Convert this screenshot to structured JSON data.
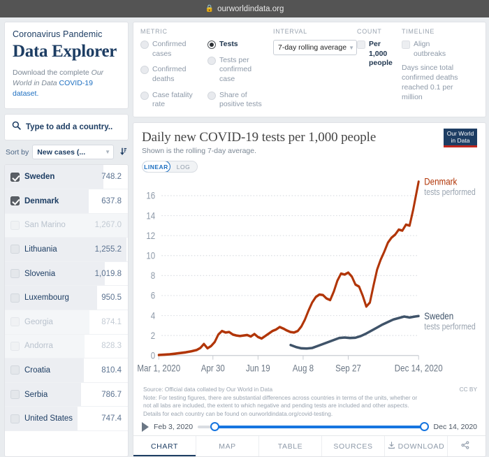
{
  "browser": {
    "url": "ourworldindata.org",
    "lock_icon": "lock-icon"
  },
  "brand": {
    "subtitle": "Coronavirus Pandemic",
    "title": "Data Explorer",
    "desc_1": "Download the complete ",
    "desc_italic": "Our World in Data",
    "desc_link": " COVID-19 dataset.",
    "desc_2": ""
  },
  "search": {
    "placeholder": "Type to add a country..",
    "value": "",
    "icon": "search-icon"
  },
  "sort": {
    "label": "Sort by",
    "value": "New cases (...",
    "direction_icon": "sort-descending-icon"
  },
  "countries": [
    {
      "name": "Sweden",
      "value": "748.2",
      "selected": true,
      "dim": false,
      "bar": 80
    },
    {
      "name": "Denmark",
      "value": "637.8",
      "selected": true,
      "dim": false,
      "bar": 68
    },
    {
      "name": "San Marino",
      "value": "1,267.0",
      "selected": false,
      "dim": true,
      "bar": 100
    },
    {
      "name": "Lithuania",
      "value": "1,255.2",
      "selected": false,
      "dim": false,
      "bar": 99
    },
    {
      "name": "Slovenia",
      "value": "1,019.8",
      "selected": false,
      "dim": false,
      "bar": 81
    },
    {
      "name": "Luxembourg",
      "value": "950.5",
      "selected": false,
      "dim": false,
      "bar": 75
    },
    {
      "name": "Georgia",
      "value": "874.1",
      "selected": false,
      "dim": true,
      "bar": 69
    },
    {
      "name": "Andorra",
      "value": "828.3",
      "selected": false,
      "dim": true,
      "bar": 65
    },
    {
      "name": "Croatia",
      "value": "810.4",
      "selected": false,
      "dim": false,
      "bar": 64
    },
    {
      "name": "Serbia",
      "value": "786.7",
      "selected": false,
      "dim": false,
      "bar": 62
    },
    {
      "name": "United States",
      "value": "747.4",
      "selected": false,
      "dim": false,
      "bar": 59
    }
  ],
  "controls": {
    "metric": {
      "label": "METRIC",
      "options_left": [
        {
          "label": "Confirmed cases",
          "selected": false
        },
        {
          "label": "Confirmed deaths",
          "selected": false
        },
        {
          "label": "Case fatality rate",
          "selected": false
        }
      ],
      "options_right": [
        {
          "label": "Tests",
          "selected": true
        },
        {
          "label": "Tests per confirmed case",
          "selected": false
        },
        {
          "label": "Share of positive tests",
          "selected": false
        }
      ]
    },
    "interval": {
      "label": "INTERVAL",
      "value": "7-day rolling average"
    },
    "count": {
      "label": "COUNT",
      "option": "Per 1,000 people",
      "checked": true
    },
    "timeline": {
      "label": "TIMELINE",
      "option": "Align outbreaks",
      "checked": false,
      "note": "Days since total confirmed deaths reached 0.1 per million"
    }
  },
  "chart": {
    "title": "Daily new COVID-19 tests per 1,000 people",
    "subtitle": "Shown is the rolling 7-day average.",
    "logo_line1": "Our World",
    "logo_line2": "in Data",
    "scale": {
      "linear": "LINEAR",
      "log": "LOG",
      "active": "LINEAR"
    },
    "source": "Source: Official data collated by Our World in Data",
    "note_line1": "Note: For testing figures, there are substantial differences across countries in terms of the units, whether or",
    "note_line2": "not all labs are included, the extent to which negative and pending tests are included and other aspects.",
    "note_line3": "Details for each country can be found on ourworldindata.org/covid-testing.",
    "license": "CC BY"
  },
  "timeline_slider": {
    "start": "Feb 3, 2020",
    "end": "Dec 14, 2020",
    "play_icon": "play-icon"
  },
  "tabs": [
    {
      "label": "CHART",
      "active": true,
      "icon": ""
    },
    {
      "label": "MAP",
      "active": false,
      "icon": ""
    },
    {
      "label": "TABLE",
      "active": false,
      "icon": ""
    },
    {
      "label": "SOURCES",
      "active": false,
      "icon": ""
    },
    {
      "label": "DOWNLOAD",
      "active": false,
      "icon": "download-icon"
    },
    {
      "label": "",
      "active": false,
      "icon": "share-icon"
    }
  ],
  "colors": {
    "denmark": "#b13507",
    "sweden": "#3f5369",
    "accent": "#1d6fc1",
    "brand_navy": "#1d3d63"
  },
  "chart_data": {
    "type": "line",
    "title": "Daily new COVID-19 tests per 1,000 people",
    "subtitle": "Shown is the rolling 7-day average.",
    "xlabel": "",
    "ylabel": "",
    "ylim": [
      0,
      17.5
    ],
    "yticks": [
      0,
      2,
      4,
      6,
      8,
      10,
      12,
      14,
      16
    ],
    "xticks": [
      "Mar 1, 2020",
      "Apr 30",
      "Jun 19",
      "Aug 8",
      "Sep 27",
      "Dec 14, 2020"
    ],
    "xtick_days": [
      0,
      60,
      110,
      160,
      210,
      288
    ],
    "grid": "horizontal-dotted",
    "legend_position": "right-inline",
    "series": [
      {
        "name": "Denmark",
        "sublabel": "tests performed",
        "color": "#b13507",
        "x": [
          0,
          6,
          12,
          18,
          24,
          30,
          36,
          42,
          46,
          50,
          54,
          58,
          62,
          66,
          70,
          74,
          78,
          82,
          86,
          90,
          94,
          98,
          102,
          106,
          110,
          114,
          118,
          122,
          126,
          130,
          134,
          138,
          142,
          146,
          150,
          154,
          158,
          162,
          166,
          170,
          174,
          178,
          182,
          186,
          190,
          194,
          198,
          202,
          206,
          210,
          214,
          218,
          222,
          226,
          230,
          234,
          238,
          242,
          246,
          250,
          254,
          258,
          262,
          266,
          270,
          274,
          278,
          282,
          285,
          288
        ],
        "y": [
          0.05,
          0.08,
          0.12,
          0.18,
          0.25,
          0.32,
          0.42,
          0.55,
          0.75,
          1.15,
          0.72,
          0.95,
          1.35,
          2.1,
          2.45,
          2.3,
          2.35,
          2.1,
          2.0,
          1.95,
          2.0,
          2.05,
          1.9,
          2.15,
          1.85,
          1.7,
          1.95,
          2.2,
          2.45,
          2.6,
          2.85,
          2.7,
          2.5,
          2.35,
          2.3,
          2.45,
          2.9,
          3.6,
          4.5,
          5.3,
          5.85,
          6.1,
          6.05,
          5.7,
          5.55,
          6.4,
          7.5,
          8.2,
          8.1,
          8.3,
          7.9,
          7.1,
          6.9,
          6.0,
          4.9,
          5.3,
          7.0,
          8.6,
          9.6,
          10.4,
          11.3,
          11.8,
          12.1,
          12.6,
          12.5,
          13.1,
          13.0,
          14.6,
          16.0,
          17.4
        ]
      },
      {
        "name": "Sweden",
        "sublabel": "tests performed",
        "color": "#3f5369",
        "x": [
          146,
          152,
          158,
          164,
          170,
          176,
          182,
          188,
          194,
          200,
          206,
          212,
          218,
          224,
          230,
          236,
          242,
          248,
          254,
          260,
          266,
          272,
          278,
          284,
          288
        ],
        "y": [
          1.05,
          0.85,
          0.72,
          0.7,
          0.75,
          0.95,
          1.15,
          1.35,
          1.55,
          1.75,
          1.8,
          1.75,
          1.78,
          1.95,
          2.2,
          2.5,
          2.8,
          3.1,
          3.35,
          3.6,
          3.75,
          3.9,
          3.8,
          3.9,
          3.95
        ]
      }
    ]
  }
}
